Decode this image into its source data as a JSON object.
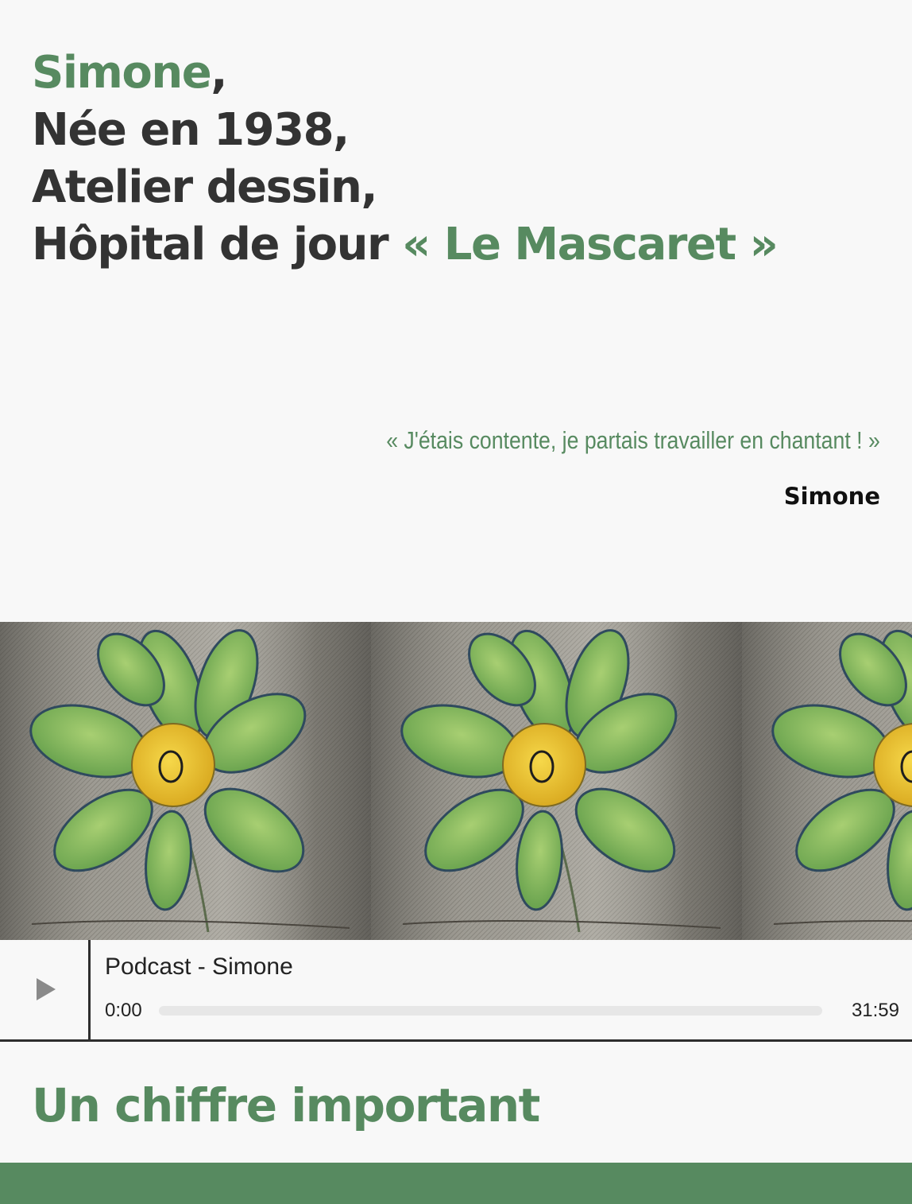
{
  "hero": {
    "name": "Simone",
    "name_suffix": ",",
    "line2": "Née en 1938,",
    "line3": "Atelier dessin,",
    "line4_prefix": "Hôpital de jour ",
    "line4_highlight": "« Le Mascaret »"
  },
  "quote": {
    "text": "« J'étais contente, je partais travailler en chantant ! »",
    "author": "Simone"
  },
  "banner": {
    "image": "flower-drawing",
    "repeats": 3
  },
  "player": {
    "title": "Podcast - Simone",
    "current_time": "0:00",
    "duration": "31:59",
    "progress": 0,
    "icon": "play-icon"
  },
  "section": {
    "title": "Un chiffre important"
  },
  "colors": {
    "accent": "#578a60",
    "text": "#333333",
    "background": "#f8f8f8"
  }
}
